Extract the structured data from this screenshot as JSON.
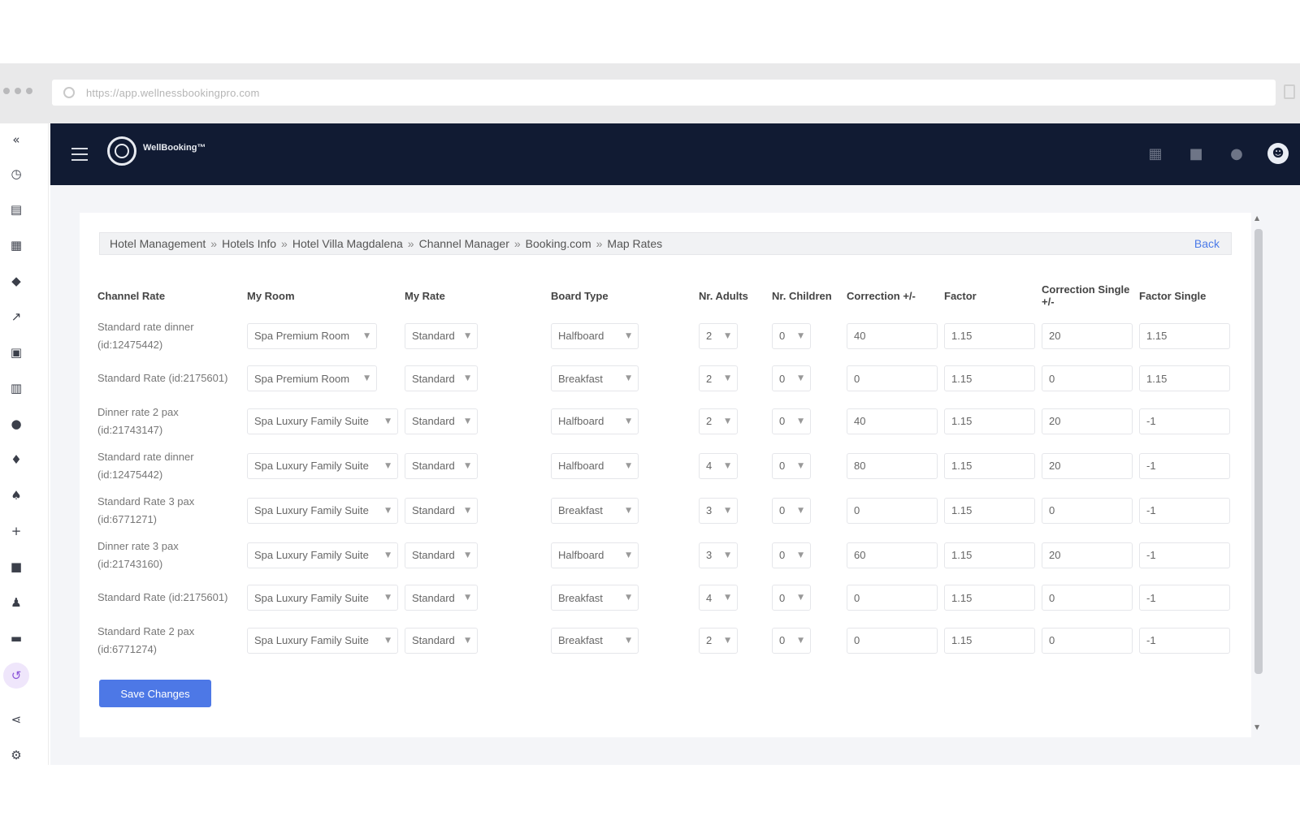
{
  "browser": {
    "url": "https://app.wellnessbookingpro.com"
  },
  "topbar": {
    "logo_text": "WellBooking™"
  },
  "breadcrumb": {
    "items": [
      "Hotel Management",
      "Hotels Info",
      "Hotel Villa Magdalena",
      "Channel Manager",
      "Booking.com",
      "Map Rates"
    ],
    "separator": "»",
    "back_label": "Back"
  },
  "table": {
    "headers": {
      "channel_rate": "Channel Rate",
      "my_room": "My Room",
      "my_rate": "My Rate",
      "board_type": "Board Type",
      "nr_adults": "Nr. Adults",
      "nr_children": "Nr. Children",
      "correction": "Correction +/-",
      "factor": "Factor",
      "correction_single": "Correction Single +/-",
      "factor_single": "Factor Single"
    },
    "rows": [
      {
        "channel_rate": "Standard rate dinner (id:12475442)",
        "my_room": "Spa Premium Room",
        "my_rate": "Standard",
        "board_type": "Halfboard",
        "adults": "2",
        "children": "0",
        "correction": "40",
        "factor": "1.15",
        "correction_single": "20",
        "factor_single": "1.15"
      },
      {
        "channel_rate": "Standard Rate (id:2175601)",
        "my_room": "Spa Premium Room",
        "my_rate": "Standard",
        "board_type": "Breakfast",
        "adults": "2",
        "children": "0",
        "correction": "0",
        "factor": "1.15",
        "correction_single": "0",
        "factor_single": "1.15"
      },
      {
        "channel_rate": "Dinner rate 2 pax (id:21743147)",
        "my_room": "Spa Luxury Family Suite",
        "my_rate": "Standard",
        "board_type": "Halfboard",
        "adults": "2",
        "children": "0",
        "correction": "40",
        "factor": "1.15",
        "correction_single": "20",
        "factor_single": "-1"
      },
      {
        "channel_rate": "Standard rate dinner (id:12475442)",
        "my_room": "Spa Luxury Family Suite",
        "my_rate": "Standard",
        "board_type": "Halfboard",
        "adults": "4",
        "children": "0",
        "correction": "80",
        "factor": "1.15",
        "correction_single": "20",
        "factor_single": "-1"
      },
      {
        "channel_rate": "Standard Rate 3 pax (id:6771271)",
        "my_room": "Spa Luxury Family Suite",
        "my_rate": "Standard",
        "board_type": "Breakfast",
        "adults": "3",
        "children": "0",
        "correction": "0",
        "factor": "1.15",
        "correction_single": "0",
        "factor_single": "-1"
      },
      {
        "channel_rate": "Dinner rate 3 pax (id:21743160)",
        "my_room": "Spa Luxury Family Suite",
        "my_rate": "Standard",
        "board_type": "Halfboard",
        "adults": "3",
        "children": "0",
        "correction": "60",
        "factor": "1.15",
        "correction_single": "20",
        "factor_single": "-1"
      },
      {
        "channel_rate": "Standard Rate (id:2175601)",
        "my_room": "Spa Luxury Family Suite",
        "my_rate": "Standard",
        "board_type": "Breakfast",
        "adults": "4",
        "children": "0",
        "correction": "0",
        "factor": "1.15",
        "correction_single": "0",
        "factor_single": "-1"
      },
      {
        "channel_rate": "Standard Rate 2 pax (id:6771274)",
        "my_room": "Spa Luxury Family Suite",
        "my_rate": "Standard",
        "board_type": "Breakfast",
        "adults": "2",
        "children": "0",
        "correction": "0",
        "factor": "1.15",
        "correction_single": "0",
        "factor_single": "-1"
      }
    ]
  },
  "actions": {
    "save_label": "Save Changes"
  },
  "colors": {
    "topbar_bg": "#111b33",
    "accent": "#4d78e6",
    "active_rail": "#8c56d9"
  }
}
